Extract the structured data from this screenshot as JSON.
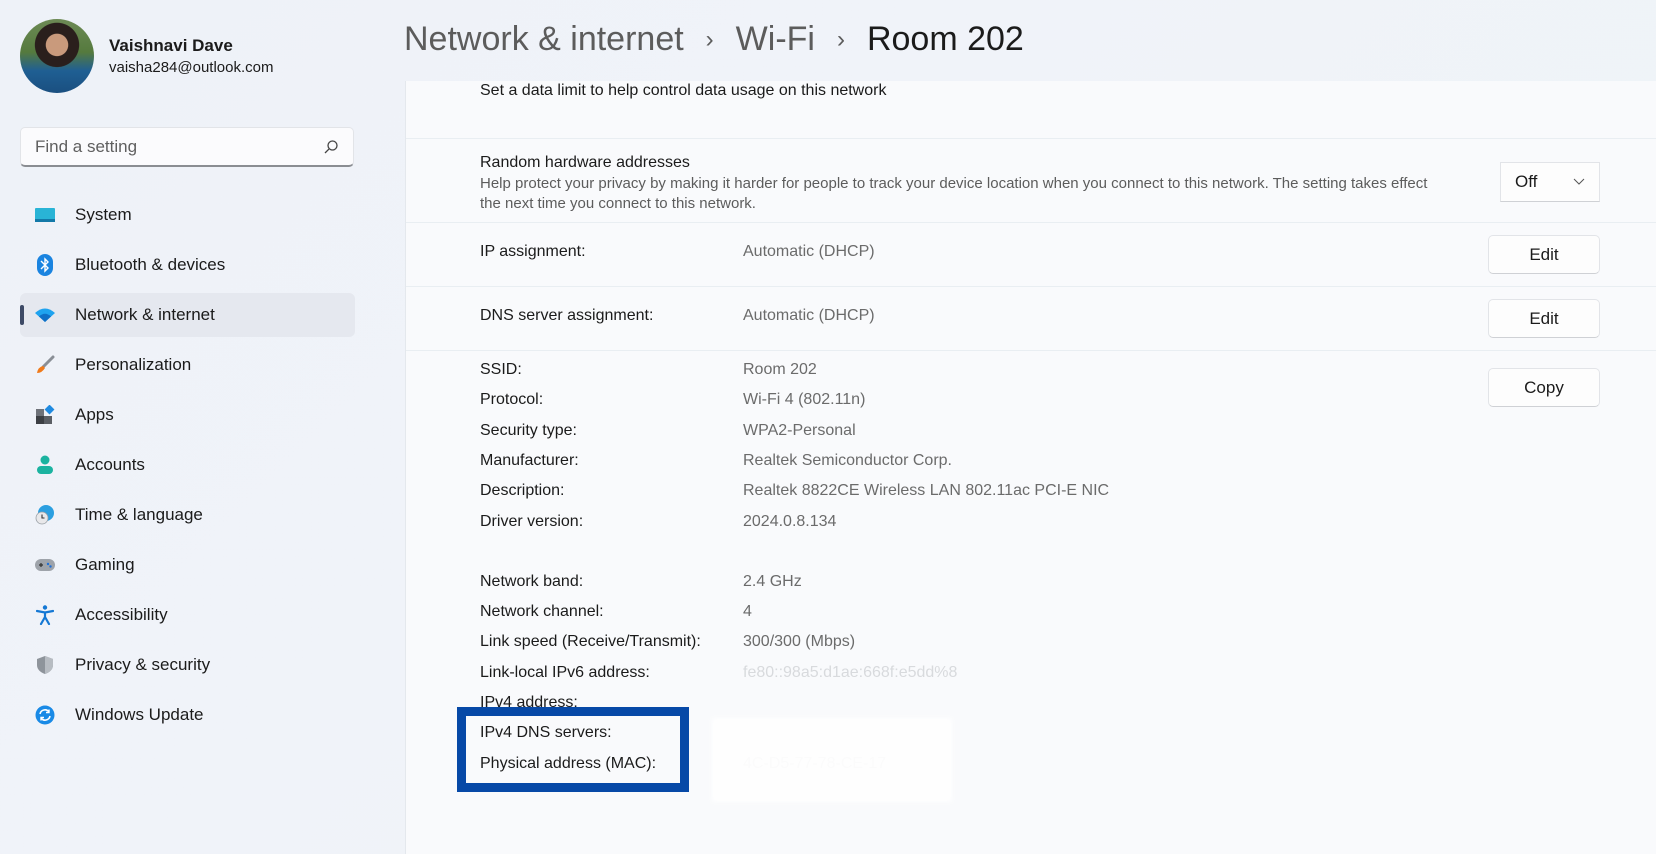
{
  "profile": {
    "name": "Vaishnavi Dave",
    "email": "vaisha284@outlook.com"
  },
  "search": {
    "placeholder": "Find a setting",
    "icon": "search-icon"
  },
  "sidebar": {
    "items": [
      {
        "label": "System",
        "icon": "system-monitor-icon",
        "active": false
      },
      {
        "label": "Bluetooth & devices",
        "icon": "bluetooth-icon",
        "active": false
      },
      {
        "label": "Network & internet",
        "icon": "wifi-icon",
        "active": true
      },
      {
        "label": "Personalization",
        "icon": "paintbrush-icon",
        "active": false
      },
      {
        "label": "Apps",
        "icon": "apps-icon",
        "active": false
      },
      {
        "label": "Accounts",
        "icon": "person-icon",
        "active": false
      },
      {
        "label": "Time & language",
        "icon": "globe-clock-icon",
        "active": false
      },
      {
        "label": "Gaming",
        "icon": "gamepad-icon",
        "active": false
      },
      {
        "label": "Accessibility",
        "icon": "accessibility-icon",
        "active": false
      },
      {
        "label": "Privacy & security",
        "icon": "shield-icon",
        "active": false
      },
      {
        "label": "Windows Update",
        "icon": "update-sync-icon",
        "active": false
      }
    ]
  },
  "breadcrumb": {
    "items": [
      "Network & internet",
      "Wi-Fi",
      "Room 202"
    ],
    "separator": "›"
  },
  "main": {
    "data_limit_desc": "Set a data limit to help control data usage on this network",
    "random_hw": {
      "title": "Random hardware addresses",
      "desc": "Help protect your privacy by making it harder for people to track your device location when you connect to this network. The setting takes effect the next time you connect to this network.",
      "value": "Off"
    },
    "ip_assignment": {
      "label": "IP assignment:",
      "value": "Automatic (DHCP)",
      "button": "Edit"
    },
    "dns_assignment": {
      "label": "DNS server assignment:",
      "value": "Automatic (DHCP)",
      "button": "Edit"
    },
    "copy_button": "Copy",
    "properties": [
      {
        "key": "SSID:",
        "value": "Room 202"
      },
      {
        "key": "Protocol:",
        "value": "Wi-Fi 4 (802.11n)"
      },
      {
        "key": "Security type:",
        "value": "WPA2-Personal"
      },
      {
        "key": "Manufacturer:",
        "value": "Realtek Semiconductor Corp."
      },
      {
        "key": "Description:",
        "value": "Realtek 8822CE Wireless LAN 802.11ac PCI-E NIC"
      },
      {
        "key": "Driver version:",
        "value": "2024.0.8.134"
      },
      {
        "key": "Network band:",
        "value": "2.4 GHz"
      },
      {
        "key": "Network channel:",
        "value": "4"
      },
      {
        "key": "Link speed (Receive/Transmit):",
        "value": "300/300 (Mbps)"
      },
      {
        "key": "Link-local IPv6 address:",
        "value": "fe80::98a5:d1ae:668f:e5dd%8"
      },
      {
        "key": "IPv4 address:",
        "value": ""
      },
      {
        "key": "IPv4 DNS servers:",
        "value": ""
      },
      {
        "key": "Physical address (MAC):",
        "value": "4C-D5-77-78-CE-17"
      }
    ]
  },
  "annotation": {
    "highlight_color": "#0749a7"
  }
}
